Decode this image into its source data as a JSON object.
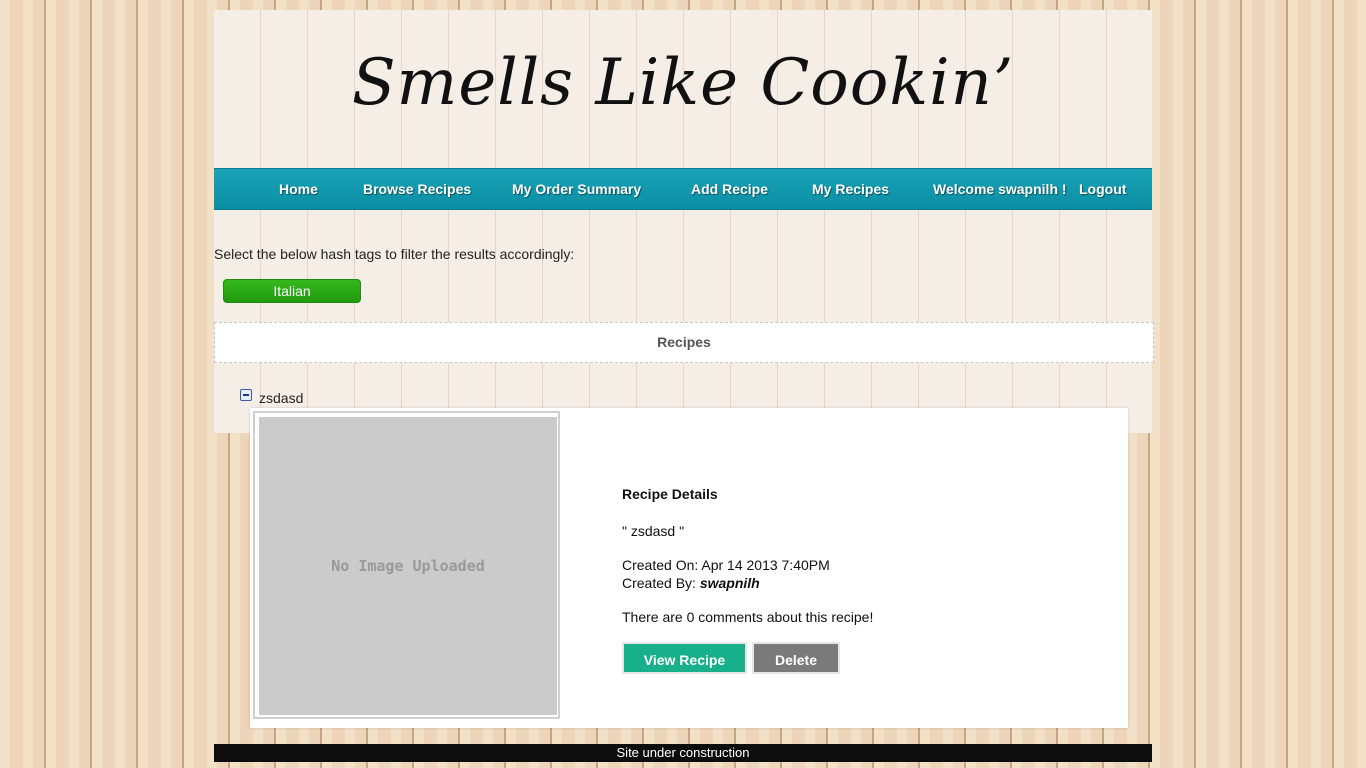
{
  "header": {
    "logo_text": "Smells Like Cookin’"
  },
  "nav": {
    "items": [
      {
        "label": "Home"
      },
      {
        "label": "Browse Recipes"
      },
      {
        "label": "My Order Summary"
      },
      {
        "label": "Add Recipe"
      },
      {
        "label": "My Recipes"
      }
    ],
    "welcome": "Welcome swapnilh !",
    "logout": "Logout"
  },
  "filters": {
    "prompt": "Select the below hash tags to filter the results accordingly:",
    "tags": [
      {
        "label": "Italian",
        "color": "#2aa815"
      }
    ]
  },
  "recipes_header": "Recipes",
  "recipe": {
    "tree_label": "zsdasd",
    "image_placeholder": "No Image Uploaded",
    "details_title": "Recipe Details",
    "name_quoted": "\" zsdasd \"",
    "created_on": "Created On: Apr 14 2013 7:40PM",
    "created_by_label": "Created By:",
    "created_by_user": "swapnilh",
    "comments_text": "There are 0 comments about this recipe!",
    "view_button": "View Recipe",
    "delete_button": "Delete"
  },
  "footer": {
    "text": "Site under construction"
  },
  "colors": {
    "nav_bg": "#0e97ab",
    "tag_green": "#2aa815",
    "view_btn": "#17b08a",
    "delete_btn": "#7a7a7a"
  }
}
